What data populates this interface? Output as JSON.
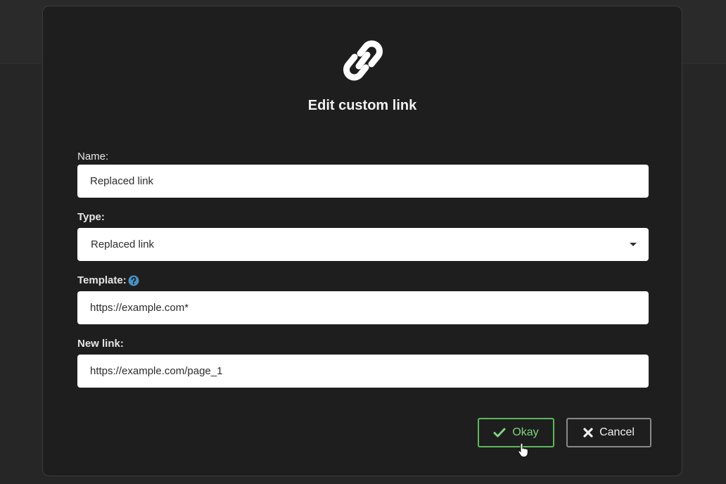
{
  "dialog": {
    "title": "Edit custom link",
    "icon": "link-icon"
  },
  "form": {
    "name_label": "Name:",
    "name_value": "Replaced link",
    "type_label": "Type:",
    "type_value": "Replaced link",
    "template_label": "Template:",
    "template_value": "https://example.com*",
    "new_link_label": "New link:",
    "new_link_value": "https://example.com/page_1"
  },
  "buttons": {
    "okay_label": "Okay",
    "cancel_label": "Cancel"
  },
  "colors": {
    "okay_accent": "#5cb85c",
    "help_icon": "#4a90c2"
  }
}
